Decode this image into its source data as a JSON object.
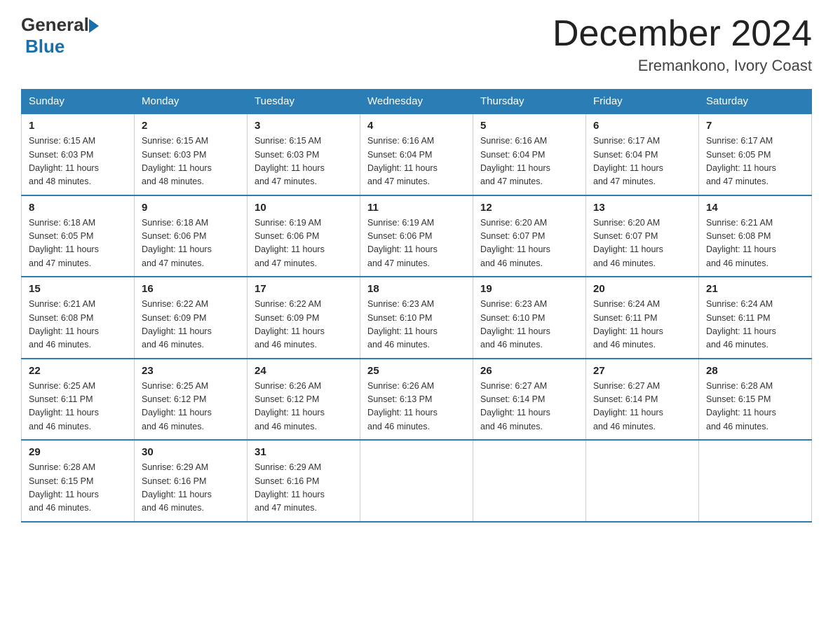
{
  "logo": {
    "general": "General",
    "blue": "Blue"
  },
  "header": {
    "month": "December 2024",
    "location": "Eremankono, Ivory Coast"
  },
  "days_of_week": [
    "Sunday",
    "Monday",
    "Tuesday",
    "Wednesday",
    "Thursday",
    "Friday",
    "Saturday"
  ],
  "weeks": [
    [
      {
        "day": "1",
        "sunrise": "6:15 AM",
        "sunset": "6:03 PM",
        "daylight": "11 hours and 48 minutes."
      },
      {
        "day": "2",
        "sunrise": "6:15 AM",
        "sunset": "6:03 PM",
        "daylight": "11 hours and 48 minutes."
      },
      {
        "day": "3",
        "sunrise": "6:15 AM",
        "sunset": "6:03 PM",
        "daylight": "11 hours and 47 minutes."
      },
      {
        "day": "4",
        "sunrise": "6:16 AM",
        "sunset": "6:04 PM",
        "daylight": "11 hours and 47 minutes."
      },
      {
        "day": "5",
        "sunrise": "6:16 AM",
        "sunset": "6:04 PM",
        "daylight": "11 hours and 47 minutes."
      },
      {
        "day": "6",
        "sunrise": "6:17 AM",
        "sunset": "6:04 PM",
        "daylight": "11 hours and 47 minutes."
      },
      {
        "day": "7",
        "sunrise": "6:17 AM",
        "sunset": "6:05 PM",
        "daylight": "11 hours and 47 minutes."
      }
    ],
    [
      {
        "day": "8",
        "sunrise": "6:18 AM",
        "sunset": "6:05 PM",
        "daylight": "11 hours and 47 minutes."
      },
      {
        "day": "9",
        "sunrise": "6:18 AM",
        "sunset": "6:06 PM",
        "daylight": "11 hours and 47 minutes."
      },
      {
        "day": "10",
        "sunrise": "6:19 AM",
        "sunset": "6:06 PM",
        "daylight": "11 hours and 47 minutes."
      },
      {
        "day": "11",
        "sunrise": "6:19 AM",
        "sunset": "6:06 PM",
        "daylight": "11 hours and 47 minutes."
      },
      {
        "day": "12",
        "sunrise": "6:20 AM",
        "sunset": "6:07 PM",
        "daylight": "11 hours and 46 minutes."
      },
      {
        "day": "13",
        "sunrise": "6:20 AM",
        "sunset": "6:07 PM",
        "daylight": "11 hours and 46 minutes."
      },
      {
        "day": "14",
        "sunrise": "6:21 AM",
        "sunset": "6:08 PM",
        "daylight": "11 hours and 46 minutes."
      }
    ],
    [
      {
        "day": "15",
        "sunrise": "6:21 AM",
        "sunset": "6:08 PM",
        "daylight": "11 hours and 46 minutes."
      },
      {
        "day": "16",
        "sunrise": "6:22 AM",
        "sunset": "6:09 PM",
        "daylight": "11 hours and 46 minutes."
      },
      {
        "day": "17",
        "sunrise": "6:22 AM",
        "sunset": "6:09 PM",
        "daylight": "11 hours and 46 minutes."
      },
      {
        "day": "18",
        "sunrise": "6:23 AM",
        "sunset": "6:10 PM",
        "daylight": "11 hours and 46 minutes."
      },
      {
        "day": "19",
        "sunrise": "6:23 AM",
        "sunset": "6:10 PM",
        "daylight": "11 hours and 46 minutes."
      },
      {
        "day": "20",
        "sunrise": "6:24 AM",
        "sunset": "6:11 PM",
        "daylight": "11 hours and 46 minutes."
      },
      {
        "day": "21",
        "sunrise": "6:24 AM",
        "sunset": "6:11 PM",
        "daylight": "11 hours and 46 minutes."
      }
    ],
    [
      {
        "day": "22",
        "sunrise": "6:25 AM",
        "sunset": "6:11 PM",
        "daylight": "11 hours and 46 minutes."
      },
      {
        "day": "23",
        "sunrise": "6:25 AM",
        "sunset": "6:12 PM",
        "daylight": "11 hours and 46 minutes."
      },
      {
        "day": "24",
        "sunrise": "6:26 AM",
        "sunset": "6:12 PM",
        "daylight": "11 hours and 46 minutes."
      },
      {
        "day": "25",
        "sunrise": "6:26 AM",
        "sunset": "6:13 PM",
        "daylight": "11 hours and 46 minutes."
      },
      {
        "day": "26",
        "sunrise": "6:27 AM",
        "sunset": "6:14 PM",
        "daylight": "11 hours and 46 minutes."
      },
      {
        "day": "27",
        "sunrise": "6:27 AM",
        "sunset": "6:14 PM",
        "daylight": "11 hours and 46 minutes."
      },
      {
        "day": "28",
        "sunrise": "6:28 AM",
        "sunset": "6:15 PM",
        "daylight": "11 hours and 46 minutes."
      }
    ],
    [
      {
        "day": "29",
        "sunrise": "6:28 AM",
        "sunset": "6:15 PM",
        "daylight": "11 hours and 46 minutes."
      },
      {
        "day": "30",
        "sunrise": "6:29 AM",
        "sunset": "6:16 PM",
        "daylight": "11 hours and 46 minutes."
      },
      {
        "day": "31",
        "sunrise": "6:29 AM",
        "sunset": "6:16 PM",
        "daylight": "11 hours and 47 minutes."
      },
      null,
      null,
      null,
      null
    ]
  ],
  "labels": {
    "sunrise": "Sunrise:",
    "sunset": "Sunset:",
    "daylight": "Daylight:"
  }
}
